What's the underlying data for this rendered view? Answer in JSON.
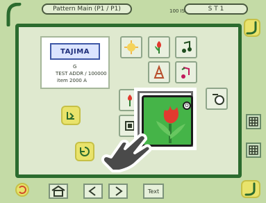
{
  "header": {
    "title": "Pattern Main (P1 / P1)",
    "center_label": "100 ISS",
    "right_label": "S T 1"
  },
  "card": {
    "brand": "TAJIMA",
    "line1": "G",
    "line2": "TEST ADDR / 100000",
    "line3": "item 2000 A"
  },
  "bottom": {
    "text_button": "Text"
  },
  "highlight_tile": {
    "corner_label": "O"
  },
  "colors": {
    "bg": "#c4dba6",
    "frame": "#2b6b2e",
    "accent_yellow": "#e9e36b",
    "tulip_red": "#e23a2f",
    "leaf_green": "#3d9b3f"
  },
  "icons": {
    "top_left": "corner-hook-icon",
    "top_right": "corner-hook-icon",
    "left": "exit-icon",
    "center": "hand-pointer-icon",
    "right_grid_1": "grid-icon",
    "right_grid_2": "grid-icon",
    "bottom_left": "undo-icon",
    "bottom_mid": "home-icon",
    "bottom_prev": "prev-arrow-icon",
    "bottom_next": "next-arrow-icon",
    "bottom_text": "text-icon",
    "bottom_right": "corner-hook-icon"
  }
}
